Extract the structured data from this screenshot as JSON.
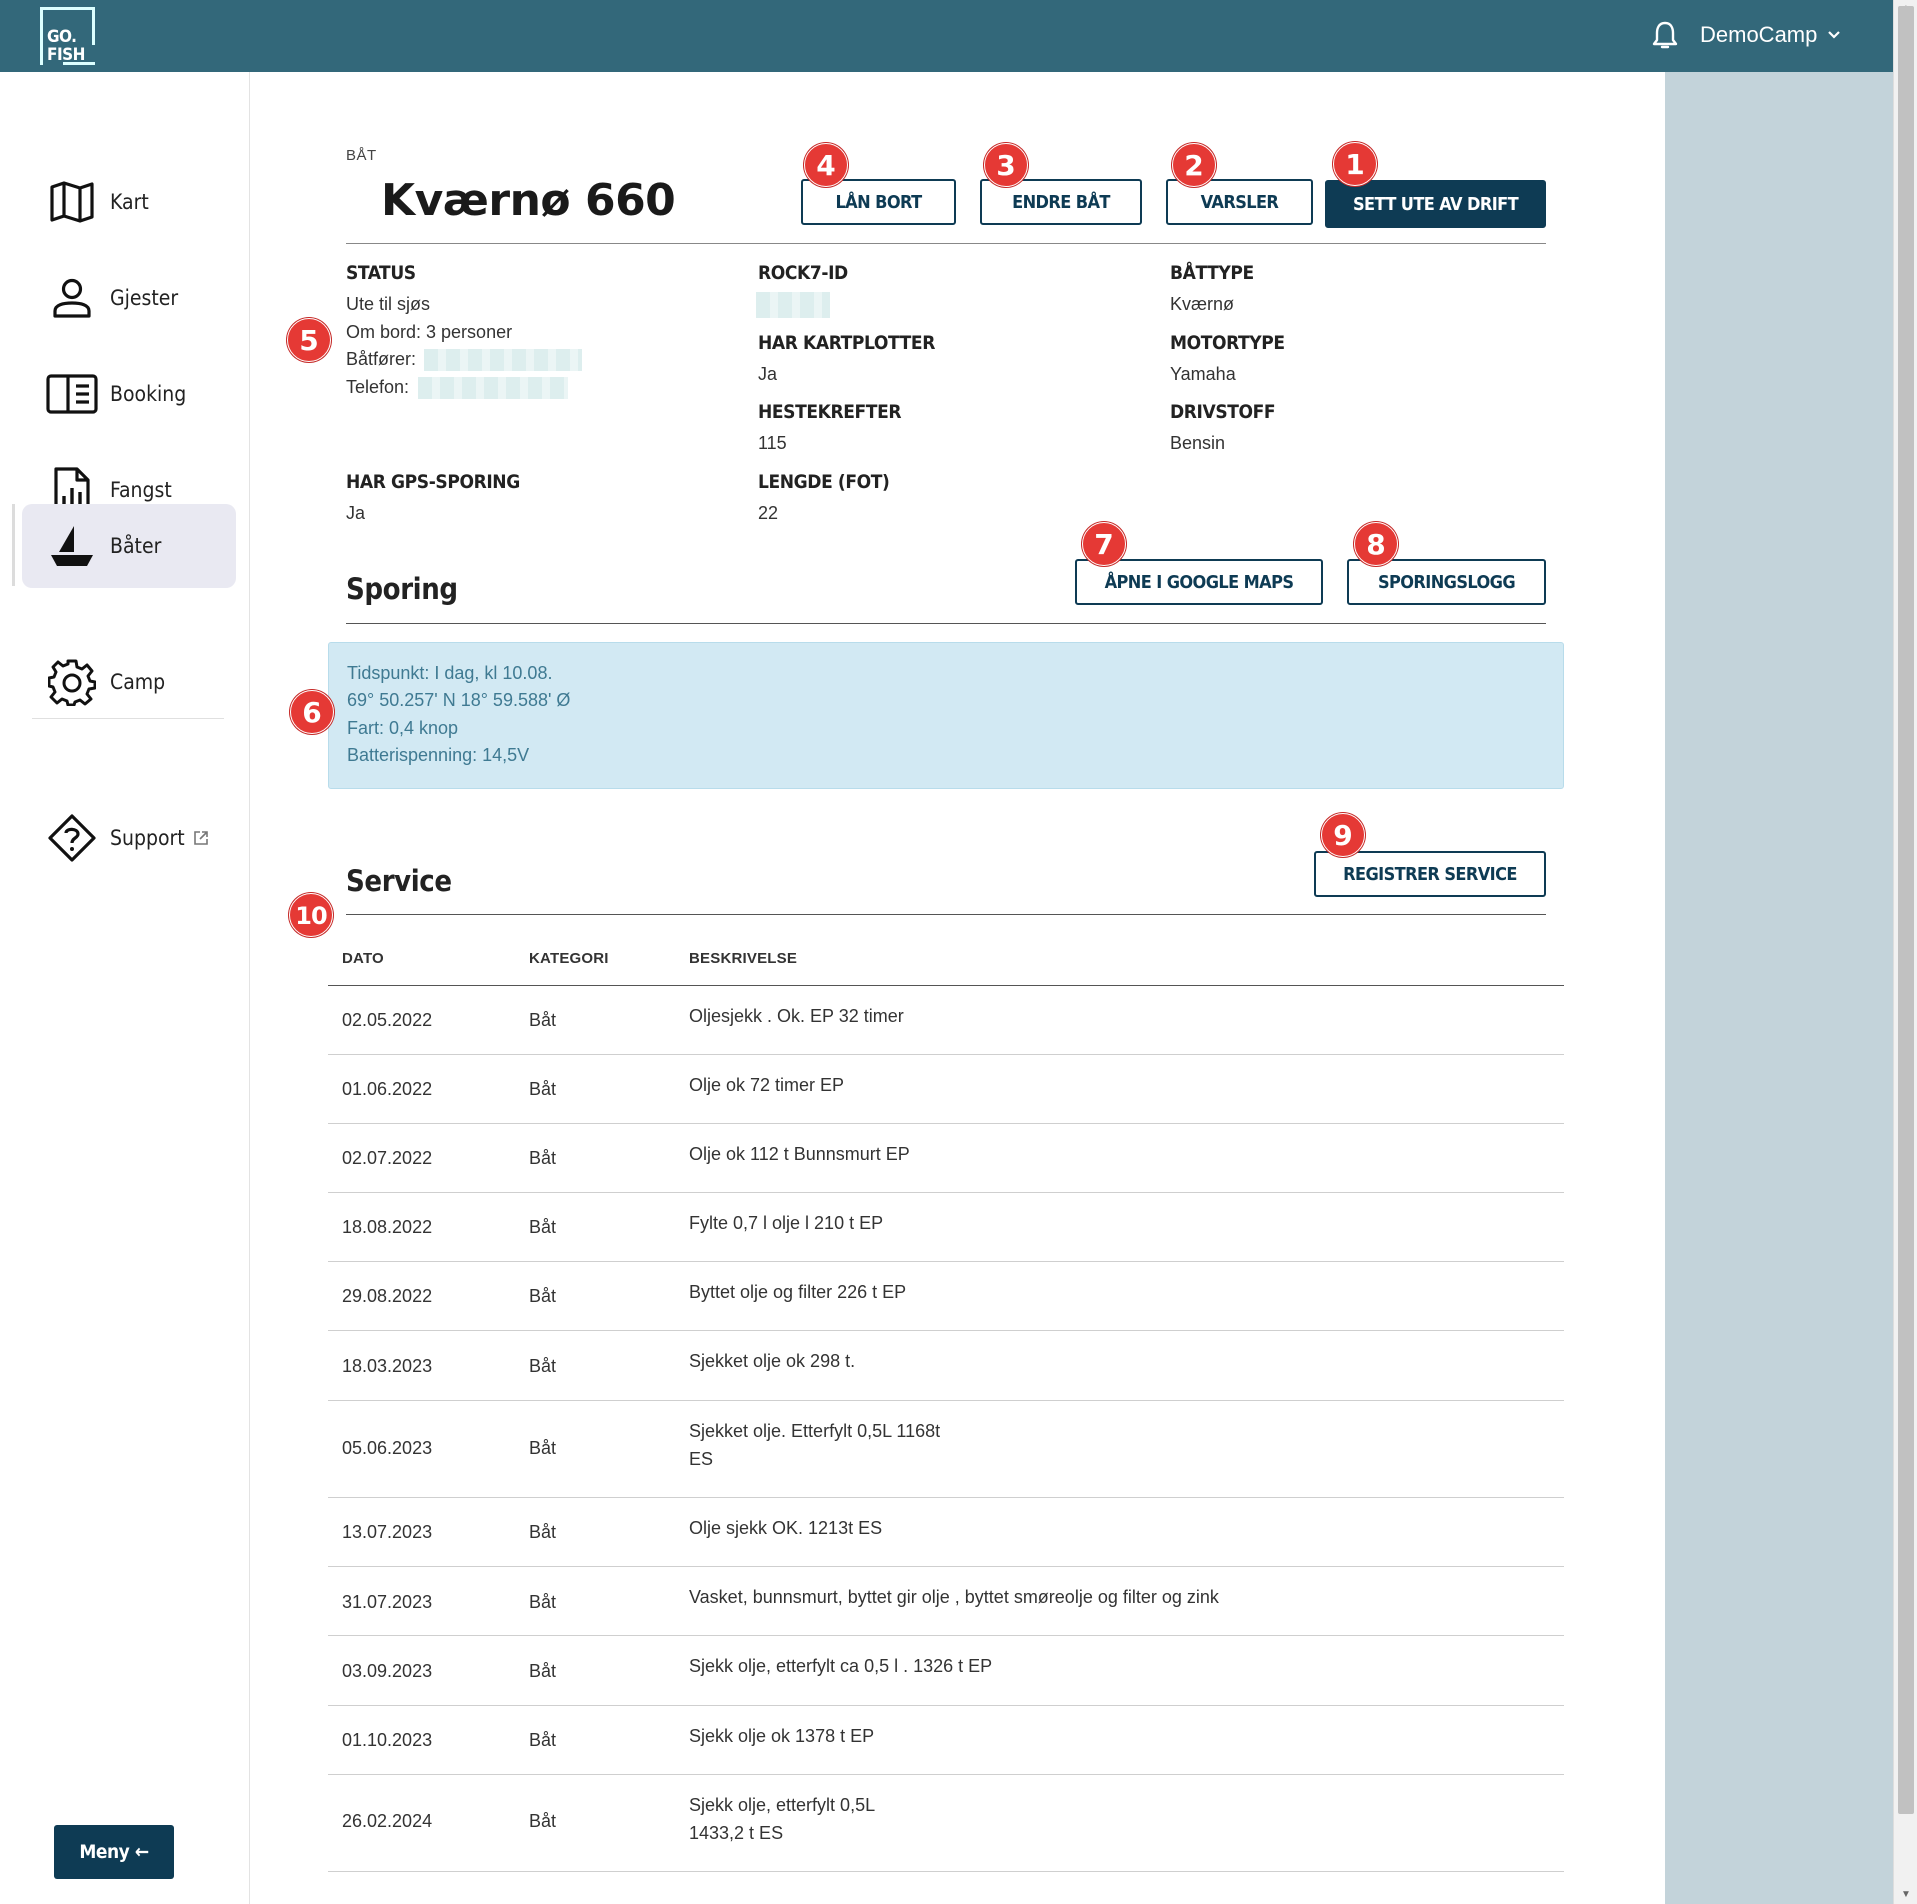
{
  "header": {
    "logo_line1": "GO.",
    "logo_line2": "FISH",
    "user": "DemoCamp",
    "bell_icon": "bell-icon",
    "chevron_icon": "chevron-down-icon"
  },
  "sidebar": {
    "items": [
      {
        "label": "Kart",
        "icon": "map-icon"
      },
      {
        "label": "Gjester",
        "icon": "person-icon"
      },
      {
        "label": "Booking",
        "icon": "book-icon"
      },
      {
        "label": "Fangst",
        "icon": "report-chart-icon"
      },
      {
        "label": "Båter",
        "icon": "boat-icon",
        "active": true
      },
      {
        "label": "Camp",
        "icon": "gear-icon"
      },
      {
        "label": "Support",
        "icon": "help-diamond-icon",
        "external": true
      }
    ],
    "menu_button": "Meny"
  },
  "boat": {
    "type_label": "BÅT",
    "name": "Kværnø 660",
    "buttons": {
      "lend": "LÅN BORT",
      "edit": "ENDRE BÅT",
      "alerts": "VARSLER",
      "out_of_service": "SETT UTE AV DRIFT"
    }
  },
  "details": {
    "status_label": "STATUS",
    "status_lines": [
      "Ute til sjøs",
      "Om bord: 3 personer",
      "Båtfører:",
      "Telefon:"
    ],
    "rock7_label": "ROCK7-ID",
    "chartplotter_label": "HAR KARTPLOTTER",
    "chartplotter_value": "Ja",
    "hp_label": "HESTEKREFTER",
    "hp_value": "115",
    "length_label": "LENGDE (FOT)",
    "length_value": "22",
    "boattype_label": "BÅTTYPE",
    "boattype_value": "Kværnø",
    "motortype_label": "MOTORTYPE",
    "motortype_value": "Yamaha",
    "fuel_label": "DRIVSTOFF",
    "fuel_value": "Bensin",
    "gps_label": "HAR GPS-SPORING",
    "gps_value": "Ja"
  },
  "tracking": {
    "title": "Sporing",
    "open_maps": "ÅPNE I GOOGLE MAPS",
    "log": "SPORINGSLOGG",
    "lines": [
      "Tidspunkt: I dag, kl 10.08.",
      "69° 50.257' N 18° 59.588' Ø",
      "Fart: 0,4 knop",
      "Batterispenning: 14,5V"
    ]
  },
  "service": {
    "title": "Service",
    "register": "REGISTRER SERVICE",
    "columns": [
      "DATO",
      "KATEGORI",
      "BESKRIVELSE"
    ],
    "rows": [
      {
        "date": "02.05.2022",
        "category": "Båt",
        "description": "Oljesjekk . Ok. EP 32 timer"
      },
      {
        "date": "01.06.2022",
        "category": "Båt",
        "description": "Olje ok 72 timer EP"
      },
      {
        "date": "02.07.2022",
        "category": "Båt",
        "description": "Olje ok 112 t Bunnsmurt EP"
      },
      {
        "date": "18.08.2022",
        "category": "Båt",
        "description": "Fylte 0,7 l olje l 210 t EP"
      },
      {
        "date": "29.08.2022",
        "category": "Båt",
        "description": "Byttet olje og filter 226 t EP"
      },
      {
        "date": "18.03.2023",
        "category": "Båt",
        "description": "Sjekket olje ok 298 t."
      },
      {
        "date": "05.06.2023",
        "category": "Båt",
        "description": "Sjekket olje. Etterfylt 0,5L 1168t\nES"
      },
      {
        "date": "13.07.2023",
        "category": "Båt",
        "description": "Olje sjekk OK. 1213t ES"
      },
      {
        "date": "31.07.2023",
        "category": "Båt",
        "description": "Vasket, bunnsmurt, byttet gir olje , byttet smøreolje og filter og zink"
      },
      {
        "date": "03.09.2023",
        "category": "Båt",
        "description": "Sjekk olje, etterfylt ca 0,5 l . 1326 t EP"
      },
      {
        "date": "01.10.2023",
        "category": "Båt",
        "description": "Sjekk olje ok 1378 t EP"
      },
      {
        "date": "26.02.2024",
        "category": "Båt",
        "description": "Sjekk olje, etterfylt 0,5L\n1433,2 t ES"
      }
    ]
  },
  "callouts": [
    "1",
    "2",
    "3",
    "4",
    "5",
    "6",
    "7",
    "8",
    "9",
    "10"
  ],
  "colors": {
    "header": "#33687a",
    "primary": "#0e3b54",
    "badge": "#e53935",
    "info_bg": "#d2e9f3",
    "right_pane": "#c3d3da"
  }
}
